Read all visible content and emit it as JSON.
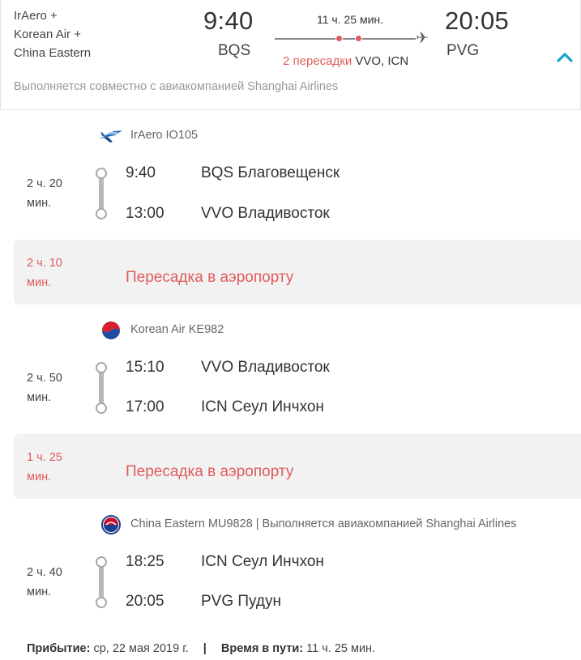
{
  "summary": {
    "airlines": [
      "IrAero +",
      "Korean Air +",
      "China Eastern"
    ],
    "departure_time": "9:40",
    "departure_code": "BQS",
    "arrival_time": "20:05",
    "arrival_code": "PVG",
    "total_duration": "11 ч. 25 мин.",
    "stops_count": "2 пересадки",
    "stops_airports": "VVO, ICN",
    "codeshare_note": "Выполняется совместно с авиакомпанией Shanghai Airlines"
  },
  "segments": [
    {
      "flight": "IrAero IO105",
      "duration": [
        "2 ч. 20",
        "мин."
      ],
      "dep_time": "9:40",
      "dep_place": "BQS Благовещенск",
      "arr_time": "13:00",
      "arr_place": "VVO Владивосток"
    },
    {
      "flight": "Korean Air KE982",
      "duration": [
        "2 ч. 50",
        "мин."
      ],
      "dep_time": "15:10",
      "dep_place": "VVO Владивосток",
      "arr_time": "17:00",
      "arr_place": "ICN Сеул Инчхон"
    },
    {
      "flight": "China Eastern MU9828 | Выполняется авиакомпанией Shanghai Airlines",
      "duration": [
        "2 ч. 40",
        "мин."
      ],
      "dep_time": "18:25",
      "dep_place": "ICN Сеул Инчхон",
      "arr_time": "20:05",
      "arr_place": "PVG Пудун"
    }
  ],
  "transfers": [
    {
      "duration": [
        "2 ч. 10",
        "мин."
      ],
      "label": "Пересадка в аэропорту"
    },
    {
      "duration": [
        "1 ч. 25",
        "мин."
      ],
      "label": "Пересадка в аэропорту"
    }
  ],
  "footer": {
    "arrival_label": "Прибытие:",
    "arrival_value": "ср, 22 мая 2019 г.",
    "separator": "|",
    "travel_label": "Время в пути:",
    "travel_value": "11 ч. 25 мин."
  },
  "icons": {
    "plane": "plane-icon",
    "collapse": "chevron-up-icon",
    "logos": [
      "iraero-logo",
      "korean-air-logo",
      "china-eastern-logo"
    ]
  },
  "colors": {
    "accent": "#1aa3c8",
    "transfer_red": "#e05c5c",
    "transfer_bg": "#f2f2f2"
  }
}
